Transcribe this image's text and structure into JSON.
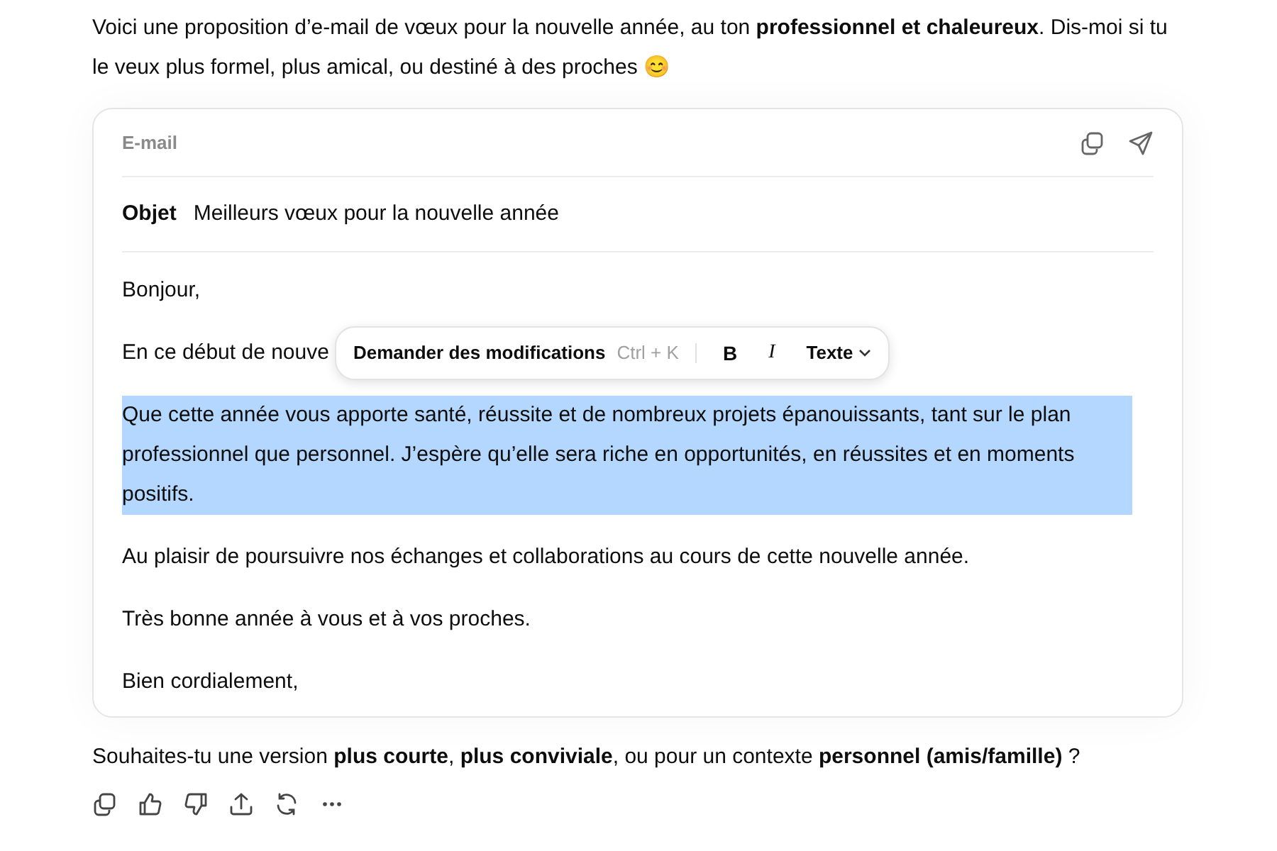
{
  "intro": "Voici une proposition d’e-mail de vœux pour la nouvelle année, au ton **professionnel et chaleureux**. Dis-moi si tu le veux plus formel, plus amical, ou destiné à des proches 😊",
  "email": {
    "label": "E-mail",
    "subject_label": "Objet",
    "subject": "Meilleurs vœux pour la nouvelle année",
    "paragraphs": [
      {
        "text": "Bonjour,",
        "selected": false
      },
      {
        "text": "En ce début de nouve",
        "selected": false
      },
      {
        "text": "Que cette année vous apporte santé, réussite et de nombreux projets épanouissants, tant sur le plan professionnel que personnel. J’espère qu’elle sera riche en opportunités, en réussites et en moments positifs.",
        "selected": true
      },
      {
        "text": "Au plaisir de poursuivre nos échanges et collaborations au cours de cette nouvelle année.",
        "selected": false
      },
      {
        "text": "Très bonne année à vous et à vos proches.",
        "selected": false
      },
      {
        "text": "Bien cordialement,",
        "selected": false
      }
    ]
  },
  "toolbar": {
    "ask": "Demander des modifications",
    "shortcut": "Ctrl + K",
    "bold": "B",
    "italic": "I",
    "style": "Texte"
  },
  "followup": "Souhaites-tu une version **plus courte**, **plus conviviale**, ou pour un contexte **personnel (amis/famille)** ?"
}
